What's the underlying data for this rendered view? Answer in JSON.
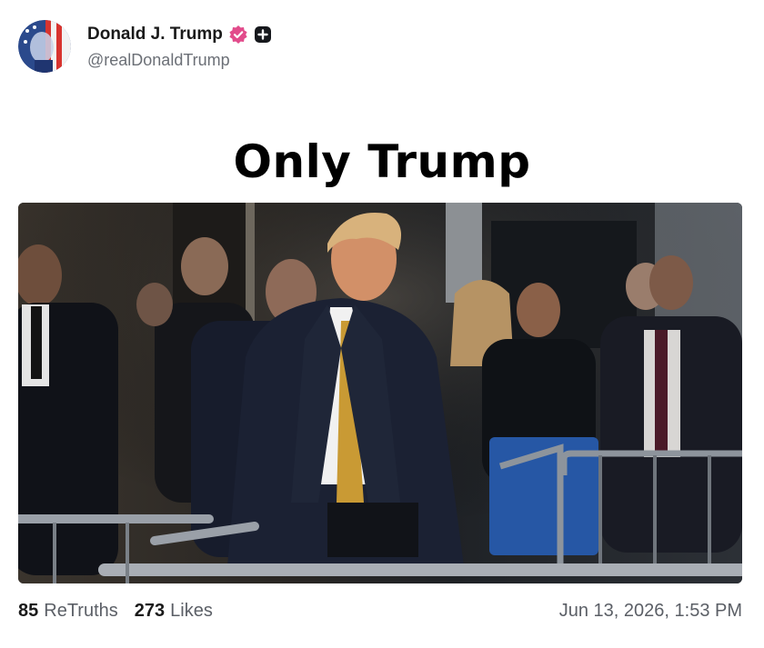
{
  "author": {
    "display_name": "Donald J. Trump",
    "handle": "@realDonaldTrump",
    "verified_badge_icon": "verified-badge-icon",
    "extra_badge_icon": "plus-square-icon"
  },
  "post": {
    "text": "Only Trump",
    "media_icon": "photo"
  },
  "stats": {
    "retruths_count": "85",
    "retruths_label": "ReTruths",
    "likes_count": "273",
    "likes_label": "Likes"
  },
  "timestamp": "Jun 13, 2026, 1:53 PM",
  "colors": {
    "verified_badge": "#e24b8b",
    "text_primary": "#1a1a1a",
    "text_secondary": "#5b5f66"
  }
}
